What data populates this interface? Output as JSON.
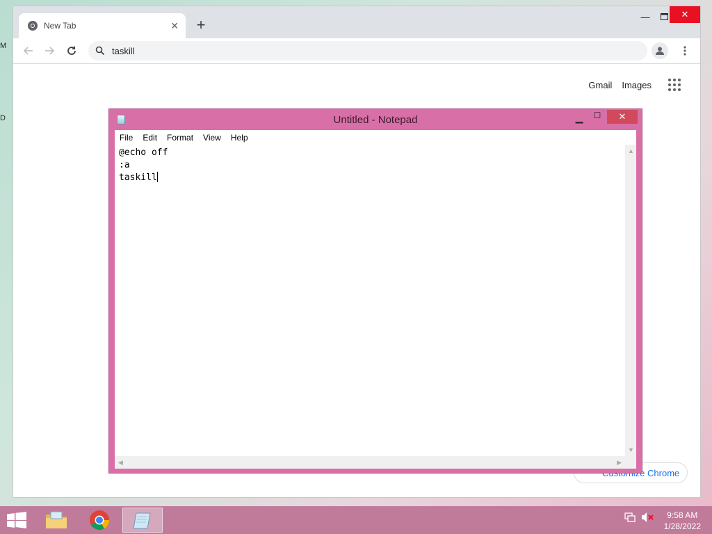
{
  "chrome": {
    "tab_title": "New Tab",
    "omnibox_text": "taskill",
    "ntp_links": {
      "gmail": "Gmail",
      "images": "Images"
    },
    "customize_label": "Customize Chrome"
  },
  "notepad": {
    "title": "Untitled - Notepad",
    "menus": [
      "File",
      "Edit",
      "Format",
      "View",
      "Help"
    ],
    "lines": [
      "@echo off",
      ":a",
      "taskill"
    ]
  },
  "taskbar": {
    "time": "9:58 AM",
    "date": "1/28/2022",
    "items": [
      "file-explorer",
      "google-chrome",
      "notepad"
    ],
    "active_item": "notepad"
  },
  "icons": {
    "chrome_favicon": "chrome-icon",
    "search": "search-icon",
    "profile": "person-icon",
    "menu": "kebab-menu-icon",
    "apps": "apps-grid-icon"
  },
  "colors": {
    "notepad_frame": "#d96fa7",
    "taskbar": "#c07a9a",
    "close_button": "#e81123",
    "link_blue": "#1a73e8"
  }
}
